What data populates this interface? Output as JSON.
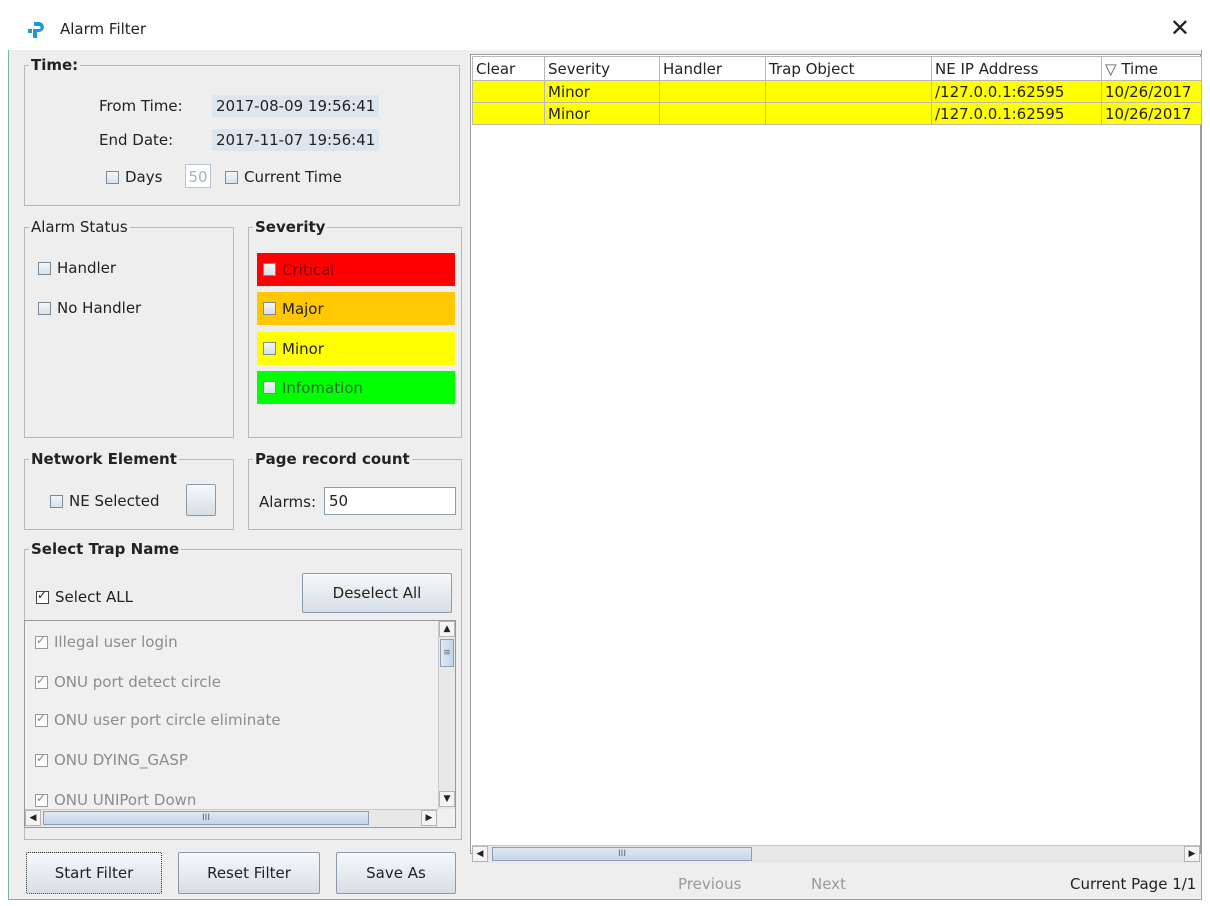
{
  "window": {
    "title": "Alarm Filter",
    "close_glyph": "✕"
  },
  "time": {
    "legend": "Time:",
    "from_label": "From Time:",
    "from_value": "2017-08-09 19:56:41",
    "end_label": "End Date:",
    "end_value": "2017-11-07 19:56:41",
    "days_label": "Days",
    "days_value": "50",
    "current_time_label": "Current Time"
  },
  "alarm_status": {
    "legend": "Alarm Status",
    "handler_label": "Handler",
    "no_handler_label": "No Handler"
  },
  "severity": {
    "legend": "Severity",
    "items": [
      {
        "label": "Critical",
        "color": "#ff0000"
      },
      {
        "label": "Major",
        "color": "#ffc800"
      },
      {
        "label": "Minor",
        "color": "#ffff00"
      },
      {
        "label": "Infomation",
        "color": "#00ff00"
      }
    ]
  },
  "network_element": {
    "legend": "Network Element",
    "ne_selected_label": "NE Selected"
  },
  "page_record": {
    "legend": "Page record count",
    "alarms_label": "Alarms:",
    "alarms_value": "50"
  },
  "trap": {
    "legend": "Select Trap Name",
    "select_all_label": "Select ALL",
    "deselect_all_label": "Deselect All",
    "items": [
      "Illegal user login",
      "ONU port detect circle",
      "ONU user port circle eliminate",
      "ONU DYING_GASP",
      "ONU UNIPort Down"
    ]
  },
  "buttons": {
    "start_filter": "Start Filter",
    "reset_filter": "Reset Filter",
    "save_as": "Save As"
  },
  "table": {
    "columns": [
      "Clear",
      "Severity",
      "Handler",
      "Trap Object",
      "NE IP Address",
      "Time"
    ],
    "sort_glyph": "▽",
    "rows": [
      [
        "",
        "Minor",
        "",
        "",
        "/127.0.0.1:62595",
        "10/26/2017"
      ],
      [
        "",
        "Minor",
        "",
        "",
        "/127.0.0.1:62595",
        "10/26/2017"
      ]
    ],
    "row_color": "#ffff00"
  },
  "pager": {
    "previous": "Previous",
    "next": "Next",
    "current_page": "Current Page 1/1"
  },
  "scroll_grip": "III"
}
